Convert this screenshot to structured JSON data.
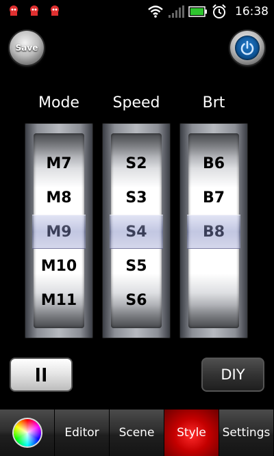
{
  "status_bar": {
    "time": "16:38",
    "notification_icons": [
      "app-notification-icon",
      "app-notification-icon",
      "app-notification-icon"
    ],
    "wifi_icon": "wifi-icon",
    "signal_icon": "signal-icon",
    "battery_icon": "battery-icon",
    "alarm_icon": "alarm-icon"
  },
  "top": {
    "save_label": "Save",
    "power_icon": "power-icon"
  },
  "pickers": [
    {
      "header": "Mode",
      "items": [
        "M7",
        "M8",
        "M9",
        "M10",
        "M11"
      ],
      "selected": "M9"
    },
    {
      "header": "Speed",
      "items": [
        "S2",
        "S3",
        "S4",
        "S5",
        "S6"
      ],
      "selected": "S4"
    },
    {
      "header": "Brt",
      "items": [
        "B6",
        "B7",
        "B8",
        "",
        ""
      ],
      "selected": "B8"
    }
  ],
  "actions": {
    "pause_icon": "pause-icon",
    "diy_label": "DIY"
  },
  "tabs": [
    {
      "label": "",
      "icon": "color-wheel-icon",
      "active": false
    },
    {
      "label": "Editor",
      "active": false
    },
    {
      "label": "Scene",
      "active": false
    },
    {
      "label": "Style",
      "active": true
    },
    {
      "label": "Settings",
      "active": false
    }
  ],
  "colors": {
    "background": "#000000",
    "active_tab": "#d00000",
    "power_blue": "#1f78c8",
    "selection_band": "#9aa0d0"
  }
}
